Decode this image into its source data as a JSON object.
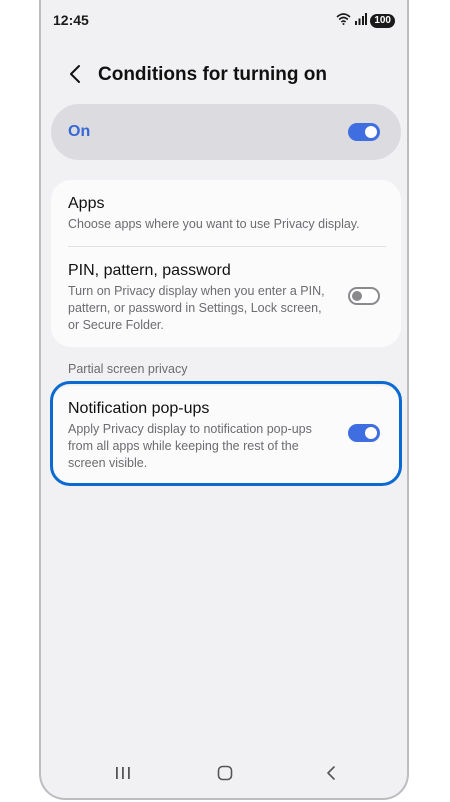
{
  "status_bar": {
    "time": "12:45",
    "battery": "100",
    "icons": [
      "wifi-icon",
      "signal-icon",
      "battery-icon"
    ]
  },
  "header": {
    "back_icon": "chevron-left-icon",
    "title": "Conditions for turning on"
  },
  "master_toggle": {
    "label": "On",
    "enabled": true
  },
  "settings": [
    {
      "title": "Apps",
      "description": "Choose apps where you want to use Privacy display."
    },
    {
      "title": "PIN, pattern, password",
      "description_lines": [
        "Turn on Privacy display when you enter a PIN,",
        "pattern, or password in Settings, Lock screen,",
        "or Secure Folder."
      ],
      "enabled": false
    }
  ],
  "section": {
    "label": "Partial screen privacy"
  },
  "notification": {
    "title": "Notification pop-ups",
    "description_lines": [
      "Apply Privacy display to notification pop-ups",
      "from all apps while keeping the rest of the",
      "screen visible."
    ],
    "enabled": true
  },
  "nav_bar": {
    "icons": [
      "recents-icon",
      "home-icon",
      "back-icon"
    ]
  },
  "colors": {
    "accent": "#3e6ee0",
    "highlight": "#0a6ad2",
    "background": "#f1f1f3"
  }
}
